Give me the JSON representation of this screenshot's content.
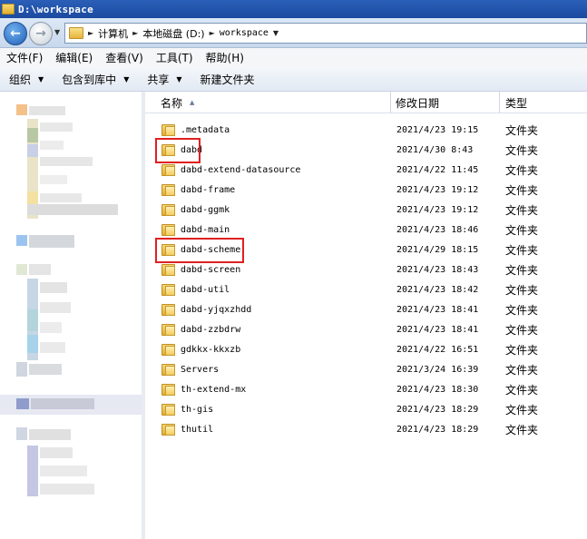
{
  "window": {
    "title": "D:\\workspace"
  },
  "address_bar": {
    "crumbs": [
      "计算机",
      "本地磁盘 (D:)",
      "workspace"
    ]
  },
  "menu": [
    "文件(F)",
    "编辑(E)",
    "查看(V)",
    "工具(T)",
    "帮助(H)"
  ],
  "toolbar": {
    "organize": "组织",
    "include_library": "包含到库中",
    "share": "共享",
    "new_folder": "新建文件夹"
  },
  "columns": {
    "name": "名称",
    "modified": "修改日期",
    "type": "类型"
  },
  "files": [
    {
      "name": ".metadata",
      "modified": "2021/4/23 19:15",
      "type": "文件夹"
    },
    {
      "name": "dabd",
      "modified": "2021/4/30 8:43",
      "type": "文件夹",
      "highlighted": true
    },
    {
      "name": "dabd-extend-datasource",
      "modified": "2021/4/22 11:45",
      "type": "文件夹"
    },
    {
      "name": "dabd-frame",
      "modified": "2021/4/23 19:12",
      "type": "文件夹"
    },
    {
      "name": "dabd-ggmk",
      "modified": "2021/4/23 19:12",
      "type": "文件夹"
    },
    {
      "name": "dabd-main",
      "modified": "2021/4/23 18:46",
      "type": "文件夹"
    },
    {
      "name": "dabd-scheme",
      "modified": "2021/4/29 18:15",
      "type": "文件夹",
      "highlighted": true
    },
    {
      "name": "dabd-screen",
      "modified": "2021/4/23 18:43",
      "type": "文件夹"
    },
    {
      "name": "dabd-util",
      "modified": "2021/4/23 18:42",
      "type": "文件夹"
    },
    {
      "name": "dabd-yjqxzhdd",
      "modified": "2021/4/23 18:41",
      "type": "文件夹"
    },
    {
      "name": "dabd-zzbdrw",
      "modified": "2021/4/23 18:41",
      "type": "文件夹"
    },
    {
      "name": "gdkkx-kkxzb",
      "modified": "2021/4/22 16:51",
      "type": "文件夹"
    },
    {
      "name": "Servers",
      "modified": "2021/3/24 16:39",
      "type": "文件夹"
    },
    {
      "name": "th-extend-mx",
      "modified": "2021/4/23 18:30",
      "type": "文件夹"
    },
    {
      "name": "th-gis",
      "modified": "2021/4/23 18:29",
      "type": "文件夹"
    },
    {
      "name": "thutil",
      "modified": "2021/4/23 18:29",
      "type": "文件夹"
    }
  ],
  "colors": {
    "titlebar": "#1c4ba0",
    "highlight_border": "#e02020"
  }
}
